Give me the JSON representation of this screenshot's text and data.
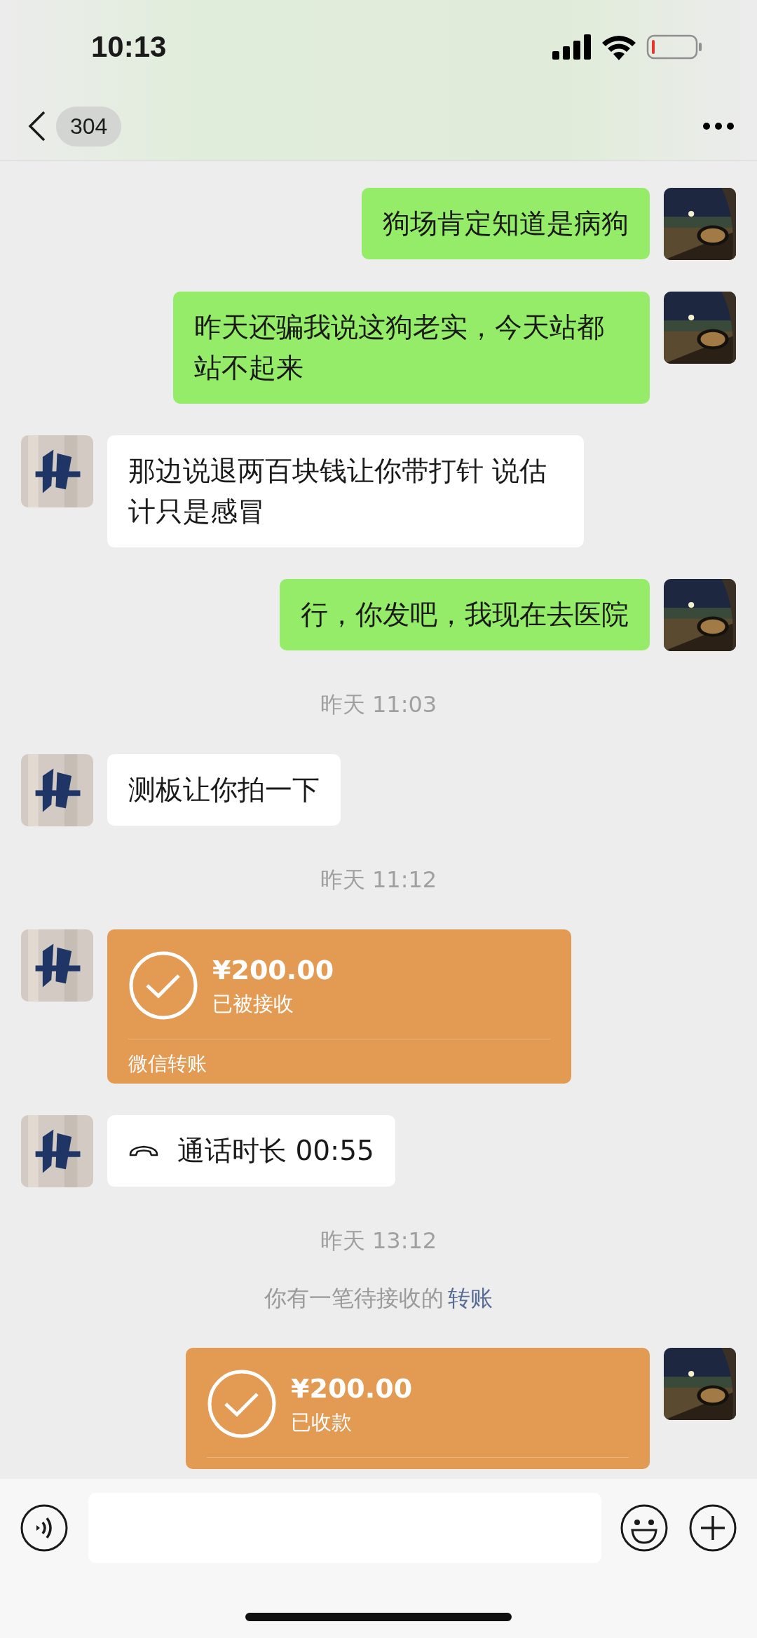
{
  "status_bar": {
    "time": "10:13"
  },
  "nav": {
    "unread_count": "304"
  },
  "messages": [
    {
      "kind": "text",
      "outgoing": true,
      "text": "狗场肯定知道是病狗"
    },
    {
      "kind": "text",
      "outgoing": true,
      "text": "昨天还骗我说这狗老实，今天站都站不起来"
    },
    {
      "kind": "text",
      "outgoing": false,
      "text": "那边说退两百块钱让你带打针 说估计只是感冒"
    },
    {
      "kind": "text",
      "outgoing": true,
      "text": "行，你发吧，我现在去医院"
    },
    {
      "kind": "time",
      "text": "昨天 11:03"
    },
    {
      "kind": "text",
      "outgoing": false,
      "text": "测板让你拍一下"
    },
    {
      "kind": "time",
      "text": "昨天 11:12"
    },
    {
      "kind": "transfer",
      "outgoing": false,
      "amount": "¥200.00",
      "status": "已被接收",
      "label": "微信转账"
    },
    {
      "kind": "call",
      "outgoing": false,
      "text": "通话时长 00:55"
    },
    {
      "kind": "time",
      "text": "昨天 13:12"
    },
    {
      "kind": "system",
      "text": "你有一笔待接收的",
      "link": "转账"
    },
    {
      "kind": "transfer",
      "outgoing": true,
      "amount": "¥200.00",
      "status": "已收款"
    }
  ]
}
